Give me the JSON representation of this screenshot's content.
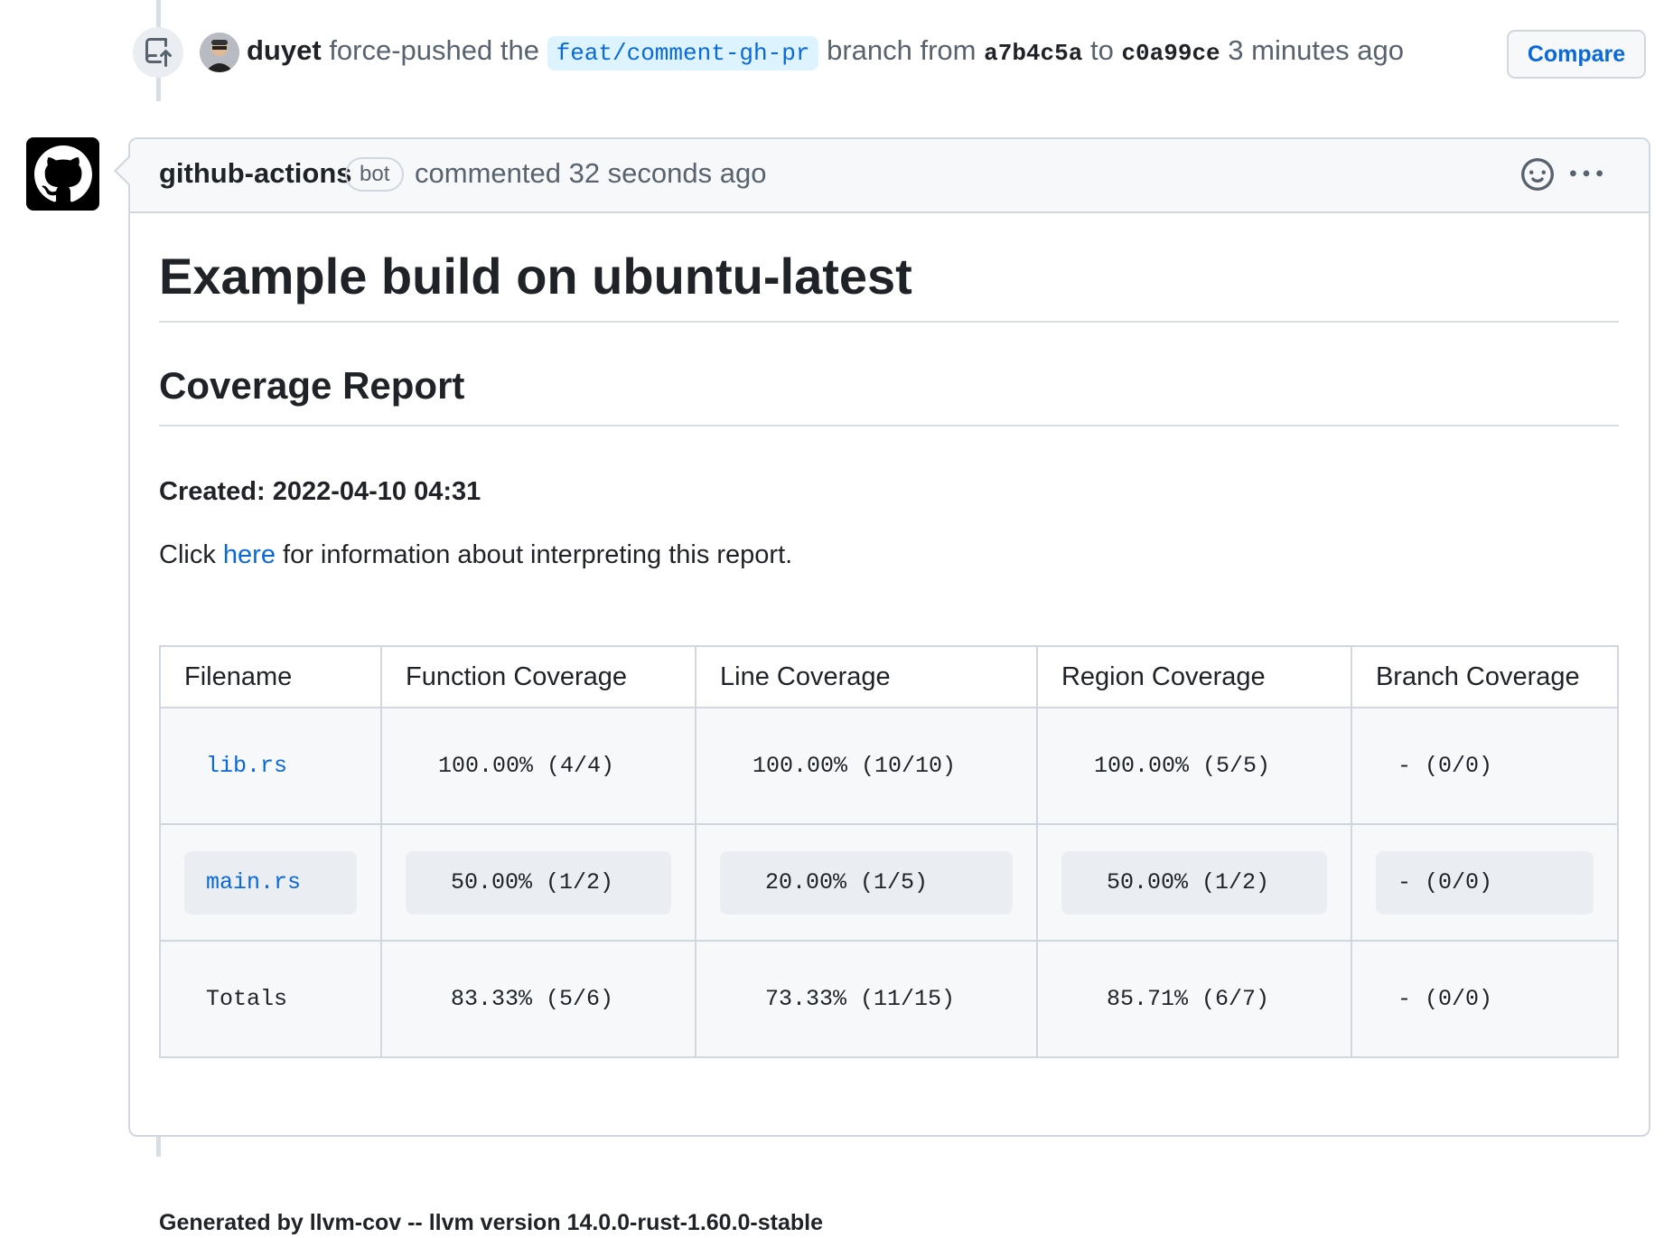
{
  "push_event": {
    "user": "duyet",
    "action_text": "force-pushed the",
    "branch": "feat/comment-gh-pr",
    "from_text": "branch from",
    "from_sha": "a7b4c5a",
    "to_text": "to",
    "to_sha": "c0a99ce",
    "time": "3 minutes ago",
    "compare_label": "Compare"
  },
  "comment": {
    "author": "github-actions",
    "badge": "bot",
    "meta": "commented 32 seconds ago",
    "title": "Example build on ubuntu-latest",
    "subtitle": "Coverage Report",
    "created": "Created: 2022-04-10 04:31",
    "click_prefix": "Click",
    "click_link": "here",
    "click_suffix": "for information about interpreting this report.",
    "table": {
      "headers": [
        "Filename",
        "Function Coverage",
        "Line Coverage",
        "Region Coverage",
        "Branch Coverage"
      ],
      "rows": [
        [
          "lib.rs",
          "100.00% (4/4)",
          "100.00% (10/10)",
          "100.00% (5/5)",
          "- (0/0)"
        ],
        [
          "main.rs",
          "50.00% (1/2)",
          "20.00% (1/5)",
          "50.00% (1/2)",
          "- (0/0)"
        ],
        [
          "Totals",
          "83.33% (5/6)",
          "73.33% (11/15)",
          "85.71% (6/7)",
          "- (0/0)"
        ]
      ]
    },
    "footer": "Generated by llvm-cov -- llvm version 14.0.0-rust-1.60.0-stable"
  },
  "colors": {
    "link": "#0969da",
    "border": "#d0d7de",
    "header_bg": "#f6f8fa"
  },
  "icons": {
    "push": "repo-push-icon",
    "bot_avatar": "github-mark-icon",
    "emoji": "smiley-icon",
    "more": "kebab-horizontal-icon"
  }
}
